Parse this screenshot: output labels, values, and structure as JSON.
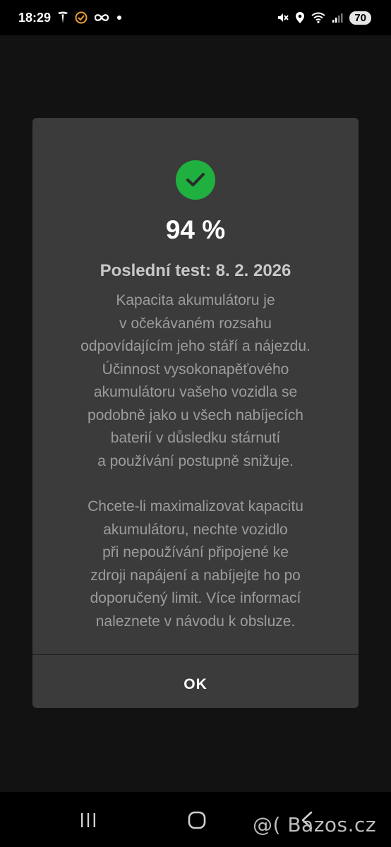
{
  "status_bar": {
    "time": "18:29",
    "battery": "70",
    "left_icons": [
      "tesla-logo-icon",
      "notification-icon",
      "infinity-icon",
      "dot-icon"
    ],
    "right_icons": [
      "vibrate-mute-icon",
      "location-icon",
      "wifi-icon",
      "signal-icon"
    ]
  },
  "dialog": {
    "status_icon": "check-circle-icon",
    "status_color": "#1fb040",
    "percent": "94 %",
    "last_test": "Poslední test: 8. 2. 2026",
    "paragraph1": [
      "Kapacita akumulátoru je",
      "v očekávaném rozsahu",
      "odpovídajícím jeho stáří a nájezdu.",
      "Účinnost vysokonapěťového",
      "akumulátoru vašeho vozidla se",
      "podobně jako u všech nabíjecích",
      "baterií v důsledku stárnutí",
      "a používání postupně snižuje."
    ],
    "paragraph2": [
      "Chcete-li maximalizovat kapacitu",
      "akumulátoru, nechte vozidlo",
      "při nepoužívání připojené ke",
      "zdroji napájení a nabíjejte ho po",
      "doporučený limit. Více informací",
      "naleznete v návodu k obsluze."
    ],
    "ok_label": "OK"
  },
  "nav_bar": {
    "buttons": [
      "recent-apps-icon",
      "home-icon",
      "back-icon"
    ]
  },
  "watermark": "@( Bazos.cz"
}
